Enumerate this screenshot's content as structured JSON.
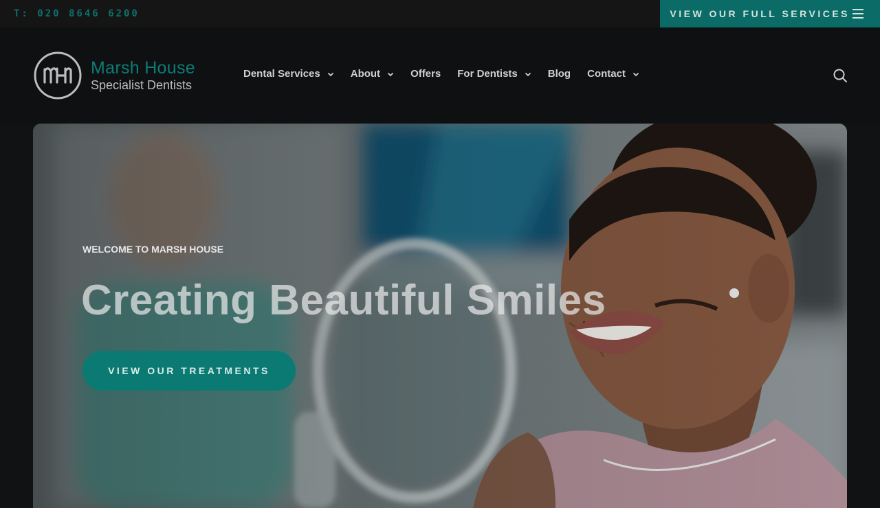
{
  "topbar": {
    "phone": "T: 020 8646 6200",
    "services_button": "VIEW OUR FULL SERVICES",
    "menu_icon": "hamburger-icon"
  },
  "header": {
    "logo": {
      "monogram_icon": "mh-monogram-icon",
      "name": "Marsh House",
      "tagline": "Specialist Dentists"
    },
    "nav": [
      {
        "label": "Dental Services",
        "has_dropdown": true
      },
      {
        "label": "About",
        "has_dropdown": true
      },
      {
        "label": "Offers",
        "has_dropdown": false
      },
      {
        "label": "For Dentists",
        "has_dropdown": true
      },
      {
        "label": "Blog",
        "has_dropdown": false
      },
      {
        "label": "Contact",
        "has_dropdown": true
      }
    ],
    "search_icon": "search-icon"
  },
  "hero": {
    "eyebrow": "WELCOME TO MARSH HOUSE",
    "headline": "Creating Beautiful Smiles",
    "cta": "VIEW OUR TREATMENTS"
  },
  "colors": {
    "accent": "#0b7a73",
    "background": "#111214",
    "brand_text": "#0c7c76"
  }
}
